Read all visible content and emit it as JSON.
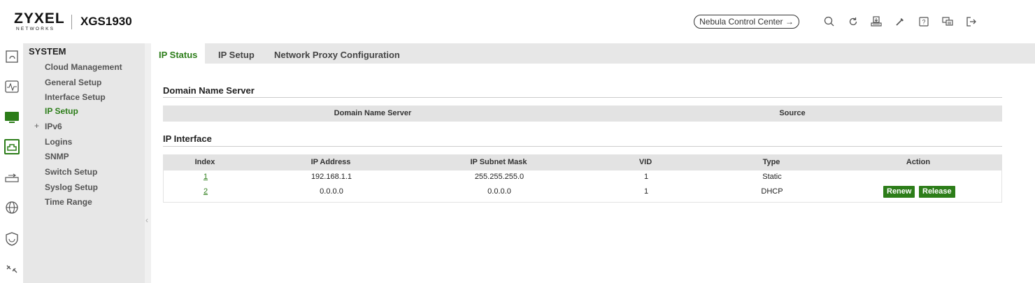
{
  "brand": {
    "logo_text": "ZYXEL",
    "logo_sub": "NETWORKS",
    "model": "XGS1930"
  },
  "header": {
    "nebula_label": "Nebula Control Center →",
    "icons": [
      "search-icon",
      "refresh-icon",
      "save-icon",
      "tools-icon",
      "help-icon",
      "chat-icon",
      "logout-icon"
    ]
  },
  "rail_icons": [
    "dashboard-icon",
    "monitor-icon",
    "system-icon",
    "port-icon",
    "switching-icon",
    "network-icon",
    "security-icon",
    "maintenance-icon"
  ],
  "sidebar": {
    "title": "SYSTEM",
    "items": [
      {
        "label": "Cloud Management",
        "active": false
      },
      {
        "label": "General Setup",
        "active": false
      },
      {
        "label": "Interface Setup",
        "active": false
      },
      {
        "label": "IP Setup",
        "active": true
      },
      {
        "label": "IPv6",
        "active": false,
        "expandable": true,
        "prefix": "+"
      },
      {
        "label": "Logins",
        "active": false
      },
      {
        "label": "SNMP",
        "active": false
      },
      {
        "label": "Switch Setup",
        "active": false
      },
      {
        "label": "Syslog Setup",
        "active": false
      },
      {
        "label": "Time Range",
        "active": false
      }
    ],
    "collapse_glyph": "‹"
  },
  "tabs": [
    {
      "label": "IP Status",
      "active": true
    },
    {
      "label": "IP Setup",
      "active": false
    },
    {
      "label": "Network Proxy Configuration",
      "active": false
    }
  ],
  "dns": {
    "title": "Domain Name Server",
    "columns": [
      "Domain Name Server",
      "Source"
    ]
  },
  "ip_interface": {
    "title": "IP Interface",
    "columns": [
      "Index",
      "IP Address",
      "IP Subnet Mask",
      "VID",
      "Type",
      "Action"
    ],
    "rows": [
      {
        "index": "1",
        "ip": "192.168.1.1",
        "mask": "255.255.255.0",
        "vid": "1",
        "type": "Static",
        "actions": []
      },
      {
        "index": "2",
        "ip": "0.0.0.0",
        "mask": "0.0.0.0",
        "vid": "1",
        "type": "DHCP",
        "actions": [
          "Renew",
          "Release"
        ]
      }
    ]
  },
  "colors": {
    "accent": "#2c7d19",
    "sidebar_bg": "#e7e7e7",
    "table_head_bg": "#e3e3e3"
  }
}
